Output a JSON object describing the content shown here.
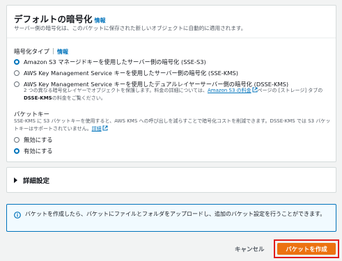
{
  "encryption": {
    "title": "デフォルトの暗号化",
    "info": "情報",
    "description": "サーバー側の暗号化は、このバケットに保存された新しいオブジェクトに自動的に適用されます。",
    "type_label": "暗号化タイプ",
    "type_info": "情報",
    "options": [
      {
        "label": "Amazon S3 マネージドキーを使用したサーバー側の暗号化 (SSE-S3)",
        "selected": true
      },
      {
        "label": "AWS Key Management Service キーを使用したサーバー側の暗号化 (SSE-KMS)",
        "selected": false
      },
      {
        "label": "AWS Key Management Service キーを使用したデュアルレイヤーサーバー側の暗号化 (DSSE-KMS)",
        "selected": false
      }
    ],
    "dsse_help_prefix": "2 つの異なる暗号化レイヤーでオブジェクトを保護します。料金の詳細については、",
    "dsse_help_link": "Amazon S3 の料金",
    "dsse_help_mid": "ページの [ストレージ] タブの",
    "dsse_help_bold": "DSSE-KMS",
    "dsse_help_suffix": "の料金をご覧ください。",
    "bucket_key_label": "バケットキー",
    "bucket_key_help": "SSE-KMS に S3 バケットキーを使用すると、AWS KMS への呼び出しを減らすことで暗号化コストを削減できます。DSSE-KMS では S3 バケットキーはサポートされていません。",
    "bucket_key_help_link": "詳細",
    "bucket_key_options": [
      {
        "label": "無効にする",
        "selected": false
      },
      {
        "label": "有効にする",
        "selected": true
      }
    ]
  },
  "advanced": {
    "title": "詳細設定"
  },
  "notice": {
    "text": "バケットを作成したら、バケットにファイルとフォルダをアップロードし、追加のバケット設定を行うことができます。"
  },
  "actions": {
    "cancel": "キャンセル",
    "create": "バケットを作成"
  },
  "colors": {
    "accent": "#0073bb",
    "primary_button": "#ec7211",
    "highlight": "#e21a1a"
  }
}
